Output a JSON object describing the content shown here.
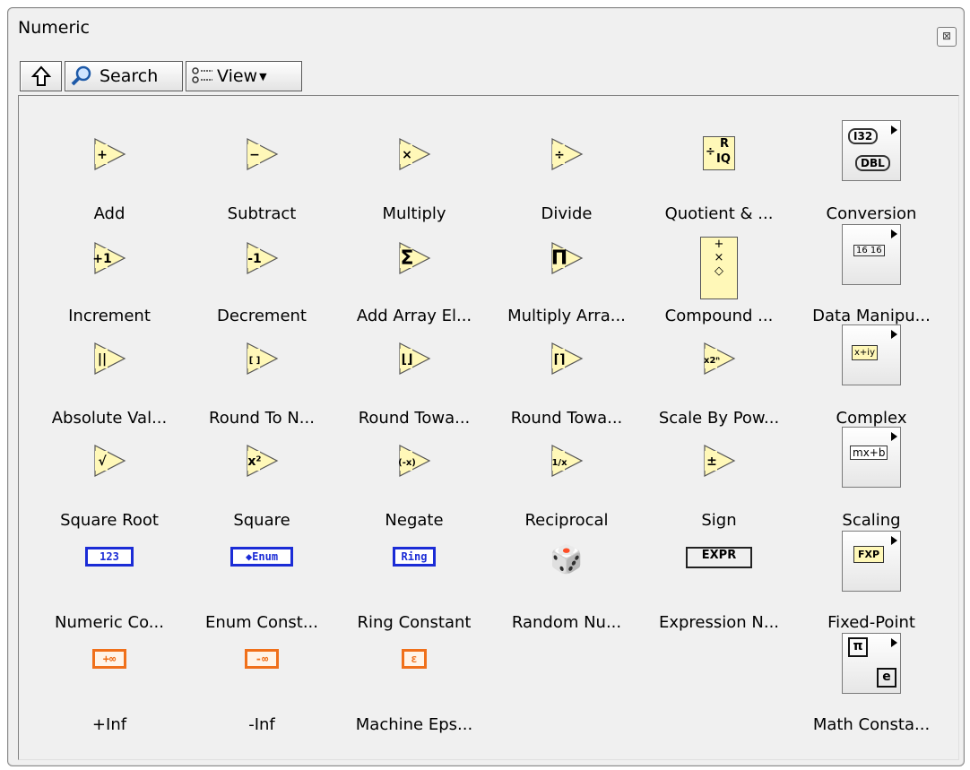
{
  "window": {
    "title": "Numeric",
    "close_glyph": "⊠"
  },
  "toolbar": {
    "up_icon": "up-arrow-icon",
    "search_label": "Search",
    "view_label": "View"
  },
  "items": [
    {
      "label": "Add",
      "glyph": "+"
    },
    {
      "label": "Subtract",
      "glyph": "−"
    },
    {
      "label": "Multiply",
      "glyph": "×"
    },
    {
      "label": "Divide",
      "glyph": "÷"
    },
    {
      "label": "Quotient & ..."
    },
    {
      "label": "Conversion"
    },
    {
      "label": "Increment",
      "glyph": "+1"
    },
    {
      "label": "Decrement",
      "glyph": "-1"
    },
    {
      "label": "Add Array El...",
      "glyph": "Σ"
    },
    {
      "label": "Multiply Arra...",
      "glyph": "Π"
    },
    {
      "label": "Compound ..."
    },
    {
      "label": "Data Manipu..."
    },
    {
      "label": "Absolute Val...",
      "glyph": "||"
    },
    {
      "label": "Round To N...",
      "glyph": "[ ]"
    },
    {
      "label": "Round Towa...",
      "glyph": "⌊⌋"
    },
    {
      "label": "Round Towa...",
      "glyph": "⌈⌉"
    },
    {
      "label": "Scale By Pow...",
      "glyph": "x2ⁿ"
    },
    {
      "label": "Complex"
    },
    {
      "label": "Square Root",
      "glyph": "√"
    },
    {
      "label": "Square",
      "glyph": "x²"
    },
    {
      "label": "Negate",
      "glyph": "(-x)"
    },
    {
      "label": "Reciprocal",
      "glyph": "1/x"
    },
    {
      "label": "Sign",
      "glyph": "±"
    },
    {
      "label": "Scaling"
    },
    {
      "label": "Numeric Co...",
      "glyph": "123"
    },
    {
      "label": "Enum Const...",
      "glyph": "◆Enum"
    },
    {
      "label": "Ring Constant",
      "glyph": "Ring"
    },
    {
      "label": "Random Nu..."
    },
    {
      "label": "Expression N...",
      "glyph": "EXPR"
    },
    {
      "label": "Fixed-Point"
    },
    {
      "label": "+Inf",
      "glyph": "+∞"
    },
    {
      "label": "-Inf",
      "glyph": "-∞"
    },
    {
      "label": "Machine Eps...",
      "glyph": "ε"
    },
    {
      "label": "Math Consta..."
    }
  ],
  "misc_glyphs": {
    "quotient_r": "R",
    "quotient_iq": "IQ",
    "conv_i32": "I32",
    "conv_dbl": "DBL",
    "datamanip": "16 16",
    "complex": "x+iy",
    "scaling": "mx+b",
    "fxp_top": "FXP",
    "math_pi": "π",
    "math_e": "e",
    "compound_ops": "+ × ◇"
  }
}
